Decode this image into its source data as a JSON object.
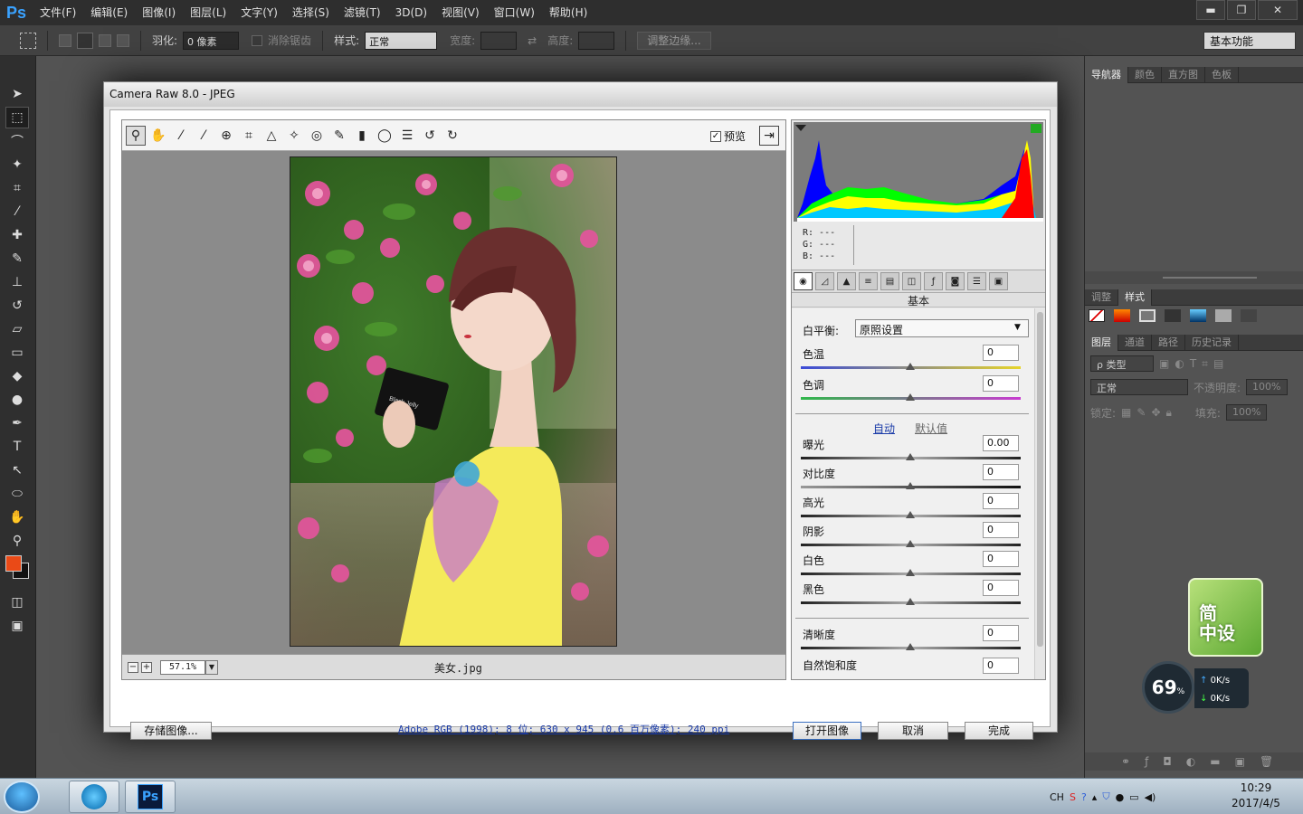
{
  "app": {
    "logo": "Ps"
  },
  "menu": [
    "文件(F)",
    "编辑(E)",
    "图像(I)",
    "图层(L)",
    "文字(Y)",
    "选择(S)",
    "滤镜(T)",
    "3D(D)",
    "视图(V)",
    "窗口(W)",
    "帮助(H)"
  ],
  "window_controls": {
    "minimize": "▬",
    "restore": "❐",
    "close": "✕"
  },
  "options": {
    "feather_label": "羽化:",
    "feather_value": "0 像素",
    "antialias_label": "消除锯齿",
    "style_label": "样式:",
    "style_value": "正常",
    "width_label": "宽度:",
    "height_label": "高度:",
    "refine_button": "调整边缘...",
    "workspace": "基本功能"
  },
  "dialog": {
    "title": "Camera Raw 8.0 -  JPEG",
    "preview_label": "预览",
    "zoom": "57.1%",
    "filename": "美女.jpg",
    "rgb": {
      "r": "R:  ---",
      "g": "G:  ---",
      "b": "B:  ---"
    },
    "section": "基本",
    "white_balance_label": "白平衡:",
    "white_balance_value": "原照设置",
    "temp": {
      "label": "色温",
      "value": "0"
    },
    "tint": {
      "label": "色调",
      "value": "0"
    },
    "auto": "自动",
    "default": "默认值",
    "sliders": [
      {
        "label": "曝光",
        "value": "0.00"
      },
      {
        "label": "对比度",
        "value": "0"
      },
      {
        "label": "高光",
        "value": "0"
      },
      {
        "label": "阴影",
        "value": "0"
      },
      {
        "label": "白色",
        "value": "0"
      },
      {
        "label": "黑色",
        "value": "0"
      }
    ],
    "clarity": {
      "label": "清晰度",
      "value": "0"
    },
    "vibrance": {
      "label": "自然饱和度",
      "value": "0"
    },
    "save_button": "存储图像...",
    "info": "Adobe RGB (1998); 8 位; 630 x 945 (0.6 百万像素); 240 ppi",
    "open_button": "打开图像",
    "cancel_button": "取消",
    "done_button": "完成",
    "card_text": "Black Jelly"
  },
  "dock": {
    "top_tabs": [
      "导航器",
      "颜色",
      "直方图",
      "色板"
    ],
    "adj_tabs": [
      "调整",
      "样式"
    ],
    "layer_tabs": [
      "图层",
      "通道",
      "路径",
      "历史记录"
    ],
    "kind": "ρ 类型",
    "blend": "正常",
    "opacity_label": "不透明度:",
    "opacity_value": "100%",
    "lock_label": "锁定:",
    "fill_label": "填充:",
    "fill_value": "100%"
  },
  "widget": {
    "line1": "简",
    "line2": "中设",
    "percent": "69",
    "percent_unit": "%",
    "up": "0K/s",
    "down": "0K/s"
  },
  "tray": {
    "lang": "CH",
    "time": "10:29",
    "date": "2017/4/5"
  }
}
